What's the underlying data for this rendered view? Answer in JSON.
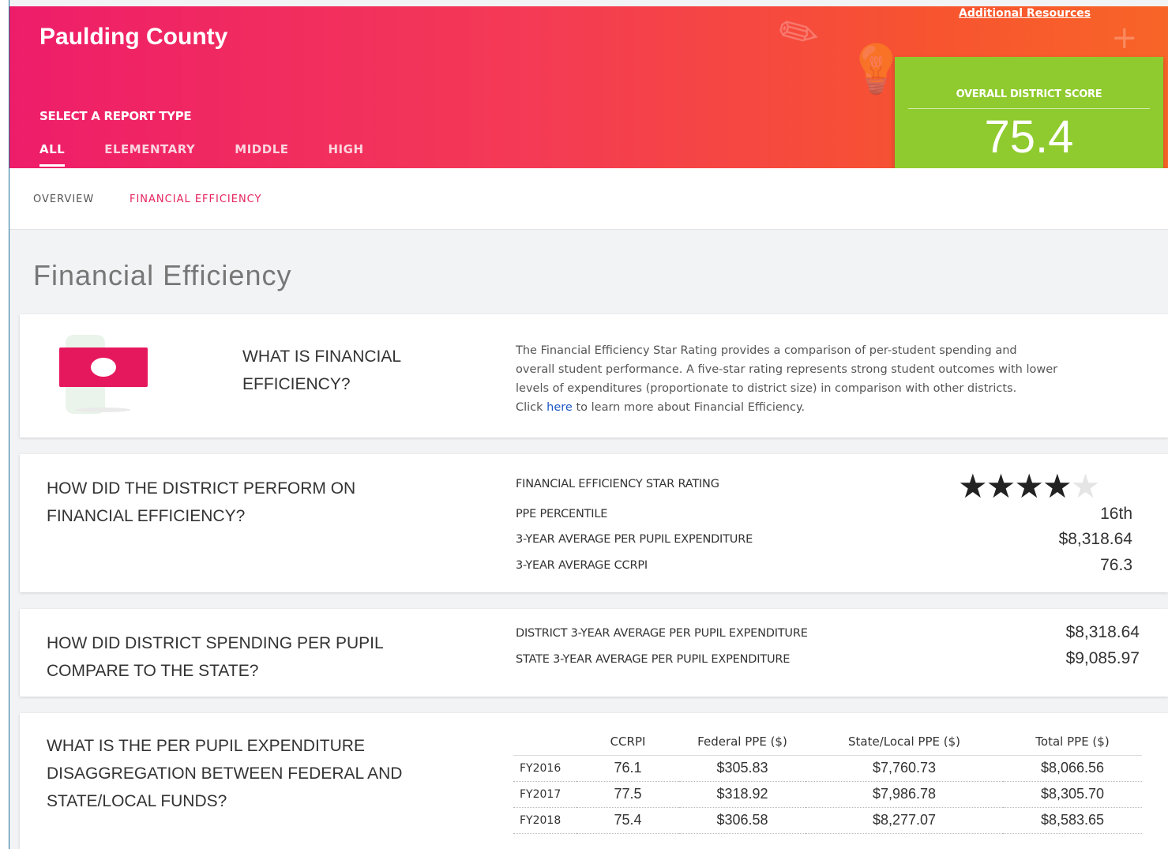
{
  "header": {
    "county": "Paulding County",
    "report_type_label": "SELECT A REPORT TYPE",
    "tabs": [
      "ALL",
      "ELEMENTARY",
      "MIDDLE",
      "HIGH"
    ],
    "additional_resources": "Additional Resources"
  },
  "score": {
    "label": "OVERALL DISTRICT SCORE",
    "value": "75.4"
  },
  "subnav": {
    "overview": "OVERVIEW",
    "financial": "FINANCIAL EFFICIENCY"
  },
  "page_title": "Financial Efficiency",
  "what_is": {
    "question_line1": "WHAT IS FINANCIAL",
    "question_line2": "EFFICIENCY?",
    "desc_line1": "The Financial Efficiency Star Rating provides a comparison of per-student spending and",
    "desc_line2": "overall student performance. A five-star rating represents strong student outcomes with lower",
    "desc_line3": "levels of expenditures (proportionate to district size) in comparison with other districts.",
    "desc_click": "Click",
    "desc_link": "here",
    "desc_tail": "to learn more about Financial Efficiency."
  },
  "perform": {
    "question_line1": "HOW DID THE DISTRICT PERFORM ON",
    "question_line2": "FINANCIAL EFFICIENCY?",
    "star_label": "FINANCIAL EFFICIENCY STAR RATING",
    "stars_filled": 4,
    "stars_total": 5,
    "ppe_percentile_label": "PPE PERCENTILE",
    "ppe_percentile": "16th",
    "avg_ppe_label": "3-YEAR AVERAGE PER PUPIL EXPENDITURE",
    "avg_ppe": "$8,318.64",
    "avg_ccrpi_label": "3-YEAR AVERAGE CCRPI",
    "avg_ccrpi": "76.3"
  },
  "compare": {
    "question_line1": "HOW DID DISTRICT SPENDING PER PUPIL",
    "question_line2": "COMPARE TO THE STATE?",
    "district_label": "DISTRICT 3-YEAR AVERAGE PER PUPIL EXPENDITURE",
    "district_value": "$8,318.64",
    "state_label": "STATE 3-YEAR AVERAGE PER PUPIL EXPENDITURE",
    "state_value": "$9,085.97"
  },
  "disagg": {
    "question_line1": "WHAT IS THE PER PUPIL EXPENDITURE",
    "question_line2": "DISAGGREGATION BETWEEN FEDERAL AND",
    "question_line3": "STATE/LOCAL FUNDS?",
    "columns": [
      "",
      "CCRPI",
      "Federal PPE ($)",
      "State/Local PPE ($)",
      "Total PPE ($)"
    ],
    "rows": [
      [
        "FY2016",
        "76.1",
        "$305.83",
        "$7,760.73",
        "$8,066.56"
      ],
      [
        "FY2017",
        "77.5",
        "$318.92",
        "$7,986.78",
        "$8,305.70"
      ],
      [
        "FY2018",
        "75.4",
        "$306.58",
        "$8,277.07",
        "$8,583.65"
      ]
    ]
  }
}
